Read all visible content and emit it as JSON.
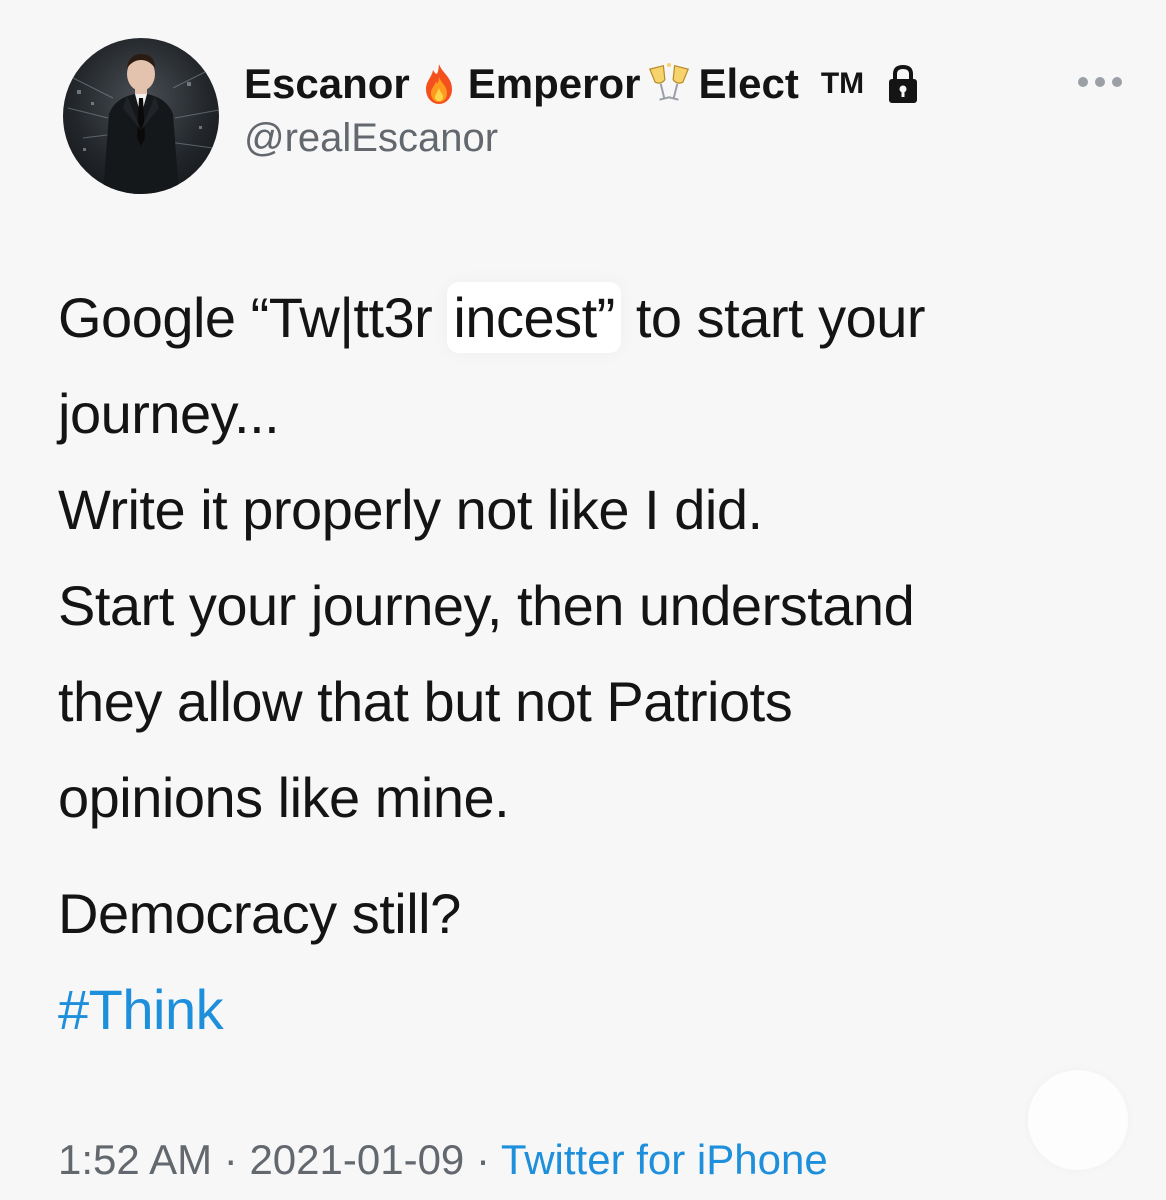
{
  "tweet": {
    "author": {
      "name_part1": "Escanor",
      "name_part2": "Emperor",
      "name_part3": "Elect",
      "trademark": "TM",
      "handle": "@realEscanor",
      "emoji1": "fire-emoji",
      "emoji2": "clinking-glasses-emoji",
      "badge_icon": "lock-icon",
      "avatar_icon": "man-in-suit-avatar"
    },
    "more_icon": "more-dots-icon",
    "text": {
      "line1_before": "Google “Tw|tt3r",
      "line1_highlight": "incest”",
      "line1_after": "to start your",
      "line2": "journey...",
      "line3": "Write it properly not like I did.",
      "line4": "Start your journey, then understand",
      "line5": "they allow that but not Patriots",
      "line6": "opinions like mine.",
      "line7": "Democracy still?",
      "hashtag": "#Think"
    },
    "meta": {
      "time": "1:52 AM",
      "separator": "·",
      "date": "2021-01-09",
      "source": "Twitter for iPhone"
    }
  },
  "colors": {
    "background": "#f7f7f8",
    "text": "#141414",
    "muted": "#62686e",
    "link": "#1d8fdb"
  }
}
